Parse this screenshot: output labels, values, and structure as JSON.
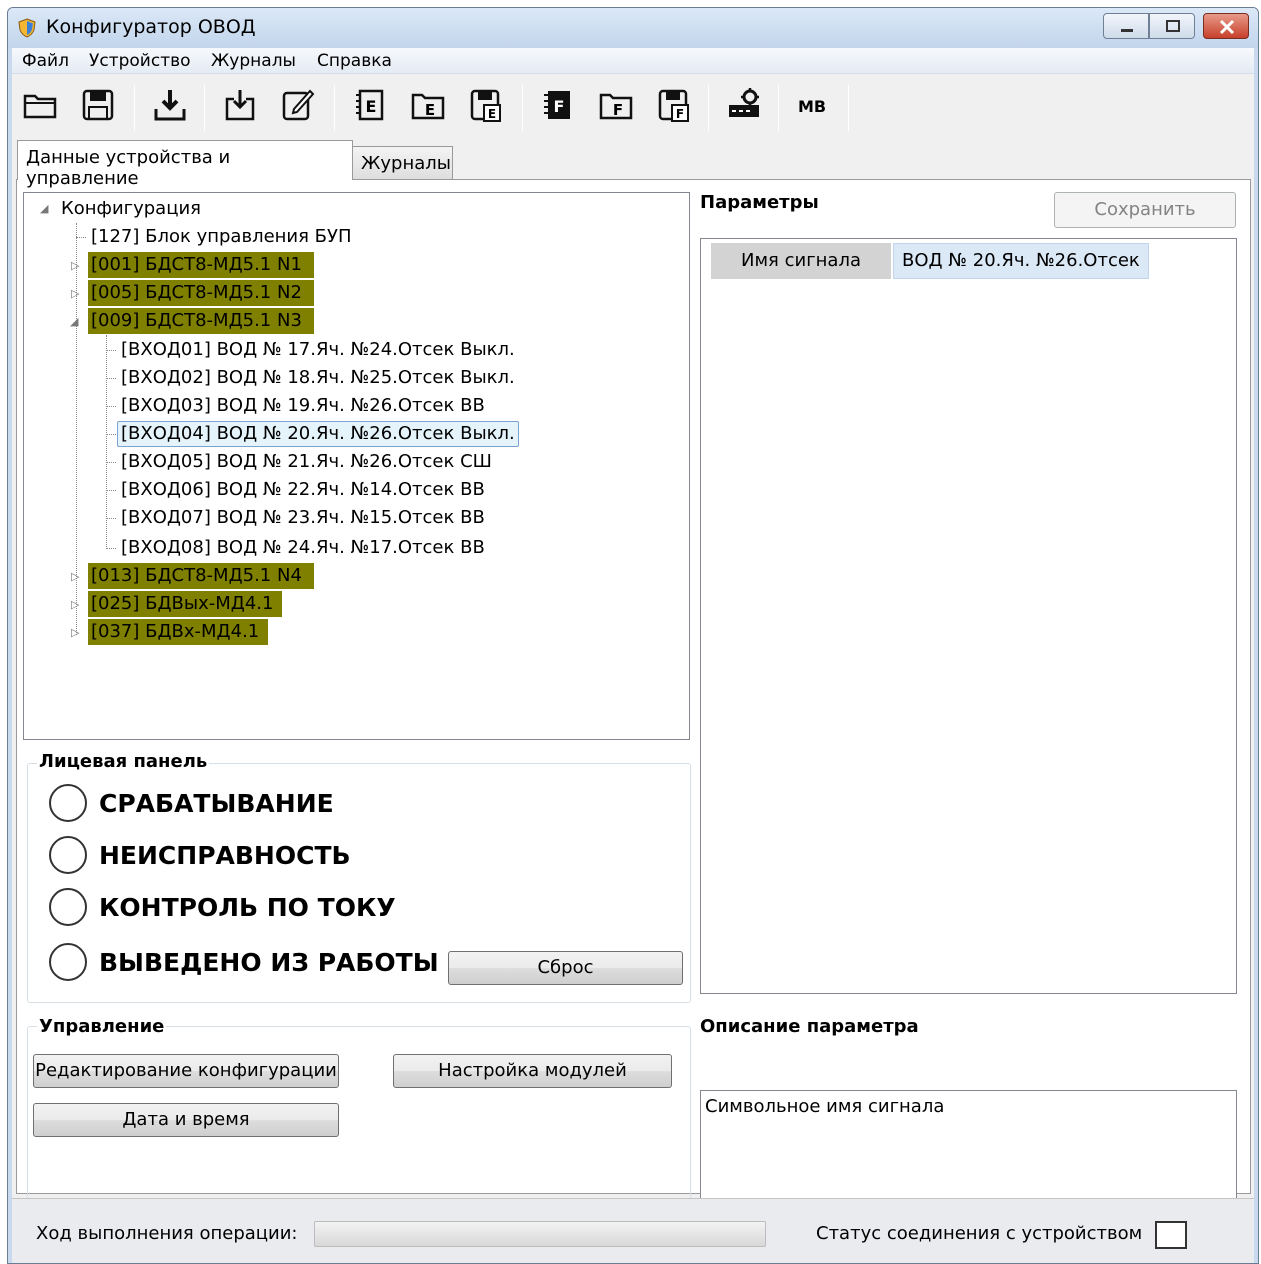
{
  "window": {
    "title": "Конфигуратор ОВОД"
  },
  "menu": [
    "Файл",
    "Устройство",
    "Журналы",
    "Справка"
  ],
  "toolbar": {
    "buttons": [
      "open-icon",
      "save-icon",
      "download-icon",
      "import-icon",
      "edit-icon",
      "e-file-icon",
      "e-folder-icon",
      "e-save-icon",
      "f-file-icon",
      "f-folder-icon",
      "f-save-icon",
      "device-settings-icon"
    ],
    "mb_label": "МВ"
  },
  "tabs": [
    "Данные устройства и управление",
    "Журналы"
  ],
  "tree": {
    "root": "Конфигурация",
    "items": [
      "[127] Блок управления БУП",
      "[001] БДСТ8-МД5.1 N1",
      "[005] БДСТ8-МД5.1 N2",
      "[009] БДСТ8-МД5.1 N3",
      "[ВХОД01] ВОД № 17.Яч. №24.Отсек Выкл.",
      "[ВХОД02] ВОД № 18.Яч. №25.Отсек Выкл.",
      "[ВХОД03] ВОД № 19.Яч. №26.Отсек ВВ",
      "[ВХОД04] ВОД № 20.Яч. №26.Отсек Выкл.",
      "[ВХОД05] ВОД № 21.Яч. №26.Отсек СШ",
      "[ВХОД06] ВОД № 22.Яч. №14.Отсек ВВ",
      "[ВХОД07] ВОД № 23.Яч. №15.Отсек ВВ",
      "[ВХОД08] ВОД № 24.Яч. №17.Отсек ВВ",
      "[013] БДСТ8-МД5.1 N4",
      "[025] БДВых-МД4.1",
      "[037] БДВх-МД4.1"
    ],
    "highlight_color": "#808000"
  },
  "front_panel": {
    "title": "Лицевая панель",
    "lamps": [
      "СРАБАТЫВАНИЕ",
      "НЕИСПРАВНОСТЬ",
      "КОНТРОЛЬ ПО ТОКУ",
      "ВЫВЕДЕНО ИЗ РАБОТЫ"
    ],
    "reset_label": "Сброс"
  },
  "control": {
    "title": "Управление",
    "edit_config_label": "Редактирование конфигурации",
    "module_setup_label": "Настройка модулей",
    "datetime_label": "Дата и время"
  },
  "params": {
    "title": "Параметры",
    "save_label": "Сохранить",
    "name_header": "Имя сигнала",
    "value": "ВОД № 20.Яч. №26.Отсек"
  },
  "description": {
    "title": "Описание параметра",
    "text": "Символьное имя сигнала"
  },
  "status": {
    "progress_label": "Ход выполнения операции:",
    "progress_fraction": 0,
    "connection_label": "Статус соединения с устройством"
  }
}
